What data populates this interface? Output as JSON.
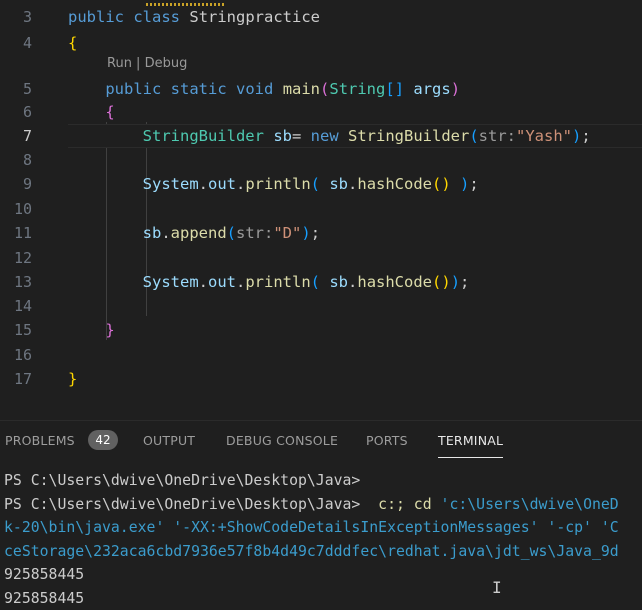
{
  "editor": {
    "lines": [
      {
        "num": "3",
        "tokens": [
          {
            "t": "public",
            "c": "kw"
          },
          {
            "t": " ",
            "c": "pu"
          },
          {
            "t": "class",
            "c": "kw"
          },
          {
            "t": " ",
            "c": "pu"
          },
          {
            "t": "Stringpractice",
            "c": "pu"
          }
        ]
      },
      {
        "num": "4",
        "tokens": [
          {
            "t": "{",
            "c": "b1"
          }
        ]
      },
      {
        "num": "5",
        "tokens": [
          {
            "t": "    public",
            "c": "kw"
          },
          {
            "t": " ",
            "c": "pu"
          },
          {
            "t": "static",
            "c": "kw"
          },
          {
            "t": " ",
            "c": "pu"
          },
          {
            "t": "void",
            "c": "kw"
          },
          {
            "t": " ",
            "c": "pu"
          },
          {
            "t": "main",
            "c": "fn"
          },
          {
            "t": "(",
            "c": "b2"
          },
          {
            "t": "String",
            "c": "ty"
          },
          {
            "t": "[]",
            "c": "b3"
          },
          {
            "t": " ",
            "c": "pu"
          },
          {
            "t": "args",
            "c": "va"
          },
          {
            "t": ")",
            "c": "b2"
          }
        ]
      },
      {
        "num": "6",
        "tokens": [
          {
            "t": "    {",
            "c": "b2"
          }
        ]
      },
      {
        "num": "7",
        "tokens": [
          {
            "t": "        StringBuilder",
            "c": "ty"
          },
          {
            "t": " ",
            "c": "pu"
          },
          {
            "t": "sb",
            "c": "va"
          },
          {
            "t": "= ",
            "c": "pu"
          },
          {
            "t": "new",
            "c": "kw"
          },
          {
            "t": " ",
            "c": "pu"
          },
          {
            "t": "StringBuilder",
            "c": "fn"
          },
          {
            "t": "(",
            "c": "b3"
          },
          {
            "t": "str:",
            "c": "hint"
          },
          {
            "t": "\"Yash\"",
            "c": "st"
          },
          {
            "t": ")",
            "c": "b3"
          },
          {
            "t": ";",
            "c": "pu"
          }
        ]
      },
      {
        "num": "8",
        "tokens": []
      },
      {
        "num": "9",
        "tokens": [
          {
            "t": "        System",
            "c": "va"
          },
          {
            "t": ".",
            "c": "pu"
          },
          {
            "t": "out",
            "c": "va"
          },
          {
            "t": ".",
            "c": "pu"
          },
          {
            "t": "println",
            "c": "fn"
          },
          {
            "t": "(",
            "c": "b3"
          },
          {
            "t": " sb",
            "c": "va"
          },
          {
            "t": ".",
            "c": "pu"
          },
          {
            "t": "hashCode",
            "c": "fn"
          },
          {
            "t": "()",
            "c": "b1"
          },
          {
            "t": " ",
            "c": "pu"
          },
          {
            "t": ")",
            "c": "b3"
          },
          {
            "t": ";",
            "c": "pu"
          }
        ]
      },
      {
        "num": "10",
        "tokens": []
      },
      {
        "num": "11",
        "tokens": [
          {
            "t": "        sb",
            "c": "va"
          },
          {
            "t": ".",
            "c": "pu"
          },
          {
            "t": "append",
            "c": "fn"
          },
          {
            "t": "(",
            "c": "b3"
          },
          {
            "t": "str:",
            "c": "hint"
          },
          {
            "t": "\"D\"",
            "c": "st"
          },
          {
            "t": ")",
            "c": "b3"
          },
          {
            "t": ";",
            "c": "pu"
          }
        ]
      },
      {
        "num": "12",
        "tokens": []
      },
      {
        "num": "13",
        "tokens": [
          {
            "t": "        System",
            "c": "va"
          },
          {
            "t": ".",
            "c": "pu"
          },
          {
            "t": "out",
            "c": "va"
          },
          {
            "t": ".",
            "c": "pu"
          },
          {
            "t": "println",
            "c": "fn"
          },
          {
            "t": "(",
            "c": "b3"
          },
          {
            "t": " sb",
            "c": "va"
          },
          {
            "t": ".",
            "c": "pu"
          },
          {
            "t": "hashCode",
            "c": "fn"
          },
          {
            "t": "()",
            "c": "b1"
          },
          {
            "t": ")",
            "c": "b3"
          },
          {
            "t": ";",
            "c": "pu"
          }
        ]
      },
      {
        "num": "14",
        "tokens": []
      },
      {
        "num": "15",
        "tokens": [
          {
            "t": "    }",
            "c": "b2"
          }
        ]
      },
      {
        "num": "16",
        "tokens": []
      },
      {
        "num": "17",
        "tokens": [
          {
            "t": "}",
            "c": "b1"
          }
        ]
      }
    ],
    "codelens": "Run | Debug",
    "current_line": "7"
  },
  "panel": {
    "tabs": [
      {
        "label": "PROBLEMS",
        "active": false
      },
      {
        "label": "OUTPUT",
        "active": false
      },
      {
        "label": "DEBUG CONSOLE",
        "active": false
      },
      {
        "label": "PORTS",
        "active": false
      },
      {
        "label": "TERMINAL",
        "active": true
      }
    ],
    "problems_count": "42"
  },
  "terminal": {
    "prompt_line": "PS C:\\Users\\dwive\\OneDrive\\Desktop\\Java>",
    "prompt_line_2": "PS C:\\Users\\dwive\\OneDrive\\Desktop\\Java> ",
    "cmd_part1": " c:; ",
    "cmd_part2": "cd ",
    "cmd_part3": "'c:\\Users\\dwive\\OneD",
    "wrap_line_1_a": "k-20\\bin\\java.exe' ",
    "wrap_line_1_b": "'-XX:+ShowCodeDetailsInExceptionMessages' '-cp' 'C",
    "wrap_line_2": "ceStorage\\232aca6cbd7936e57f8b4d49c7dddfec\\redhat.java\\jdt_ws\\Java_9d",
    "output": [
      "925858445",
      "925858445"
    ]
  },
  "colors": {
    "background": "#1f1f1f",
    "keyword": "#569cd6",
    "type": "#4ec9b0",
    "function": "#dcdcaa",
    "variable": "#9cdcfe",
    "string": "#ce9178"
  }
}
